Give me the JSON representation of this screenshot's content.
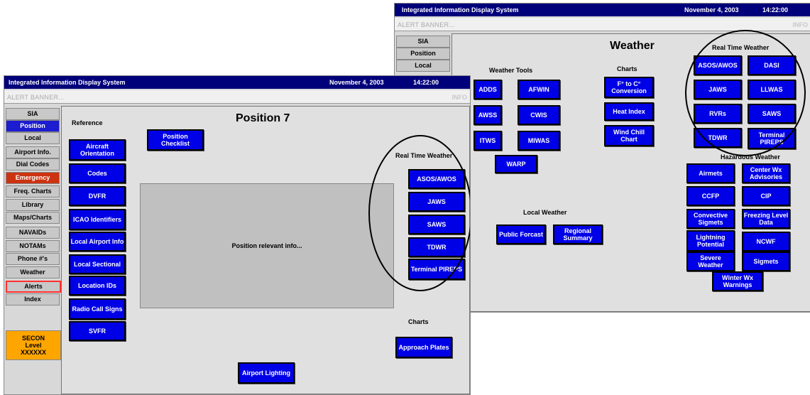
{
  "back_window": {
    "title": "Integrated Information Display System",
    "date": "November 4, 2003",
    "time": "14:22:00",
    "alert_banner": "ALERT BANNER...",
    "info": "INFO",
    "page_title": "Weather",
    "sidebar_visible": [
      "SIA",
      "Position",
      "Local"
    ],
    "weather_tools_header": "Weather Tools",
    "weather_tools": [
      "ADDS",
      "AFWIN",
      "AWSS",
      "CWIS",
      "ITWS",
      "MIWAS",
      "WARP"
    ],
    "charts_header": "Charts",
    "charts": [
      "F° to C° Conversion",
      "Heat Index",
      "Wind Chill Chart"
    ],
    "local_weather_header": "Local Weather",
    "local_weather": [
      "Public Forcast",
      "Regional Summary"
    ],
    "real_time_header": "Real Time Weather",
    "real_time": [
      "ASOS/AWOS",
      "DASI",
      "JAWS",
      "LLWAS",
      "RVRs",
      "SAWS",
      "TDWR",
      "Terminal PIREPS"
    ],
    "hazardous_header": "Hazardous Weather",
    "hazardous": [
      "Airmets",
      "Center Wx Advisories",
      "CCFP",
      "CIP",
      "Convective Sigmets",
      "Freezing Level Data",
      "Lightning Potential",
      "NCWF",
      "Severe Weather",
      "Sigmets",
      "Winter Wx Warnings"
    ]
  },
  "front_window": {
    "title": "Integrated Information Display System",
    "date": "November 4, 2003",
    "time": "14:22:00",
    "alert_banner": "ALERT BANNER...",
    "info": "INFO",
    "page_title": "Position 7",
    "sidebar": [
      "SIA",
      "Position",
      "Local",
      "Airport Info.",
      "Dial Codes",
      "Emergency",
      "Freq. Charts",
      "Library",
      "Maps/Charts",
      "NAVAIDs",
      "NOTAMs",
      "Phone #'s",
      "Weather",
      "Alerts",
      "Index"
    ],
    "secon": [
      "SECON",
      "Level",
      "XXXXXX"
    ],
    "reference_header": "Reference",
    "reference": [
      "Aircraft Orientation",
      "Codes",
      "DVFR",
      "ICAO Identifiers",
      "Local Airport Info",
      "Local Sectional",
      "Location IDs",
      "Radio Call Signs",
      "SVFR"
    ],
    "position_checklist": "Position Checklist",
    "info_box": "Position relevant info...",
    "real_time_header": "Real Time Weather",
    "real_time": [
      "ASOS/AWOS",
      "JAWS",
      "SAWS",
      "TDWR",
      "Terminal PIREPS"
    ],
    "charts_header": "Charts",
    "approach_plates": "Approach Plates",
    "airport_lighting": "Airport Lighting"
  }
}
